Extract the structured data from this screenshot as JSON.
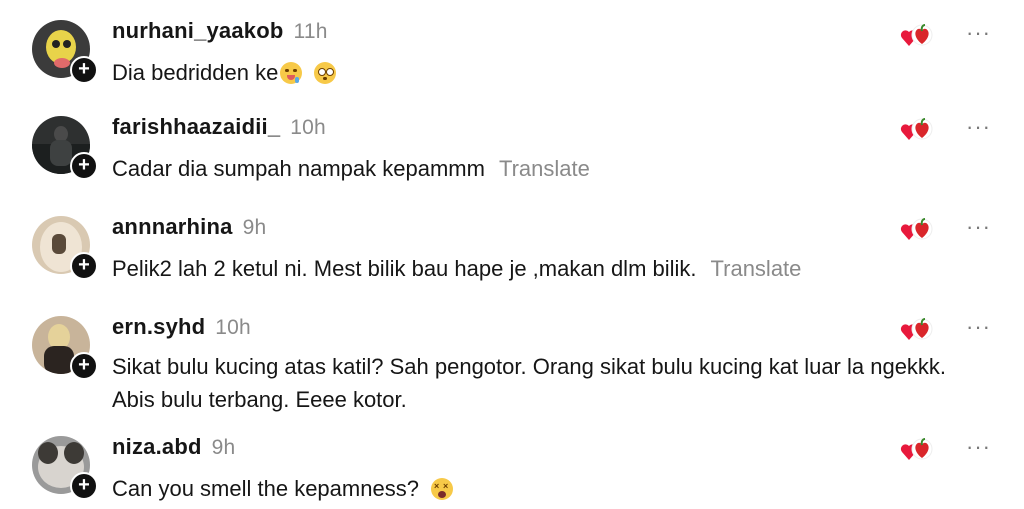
{
  "comments": [
    {
      "username": "nurhani_yaakob",
      "time": "11h",
      "text": "Dia bedridden ke",
      "translate": "",
      "avatar_color": "#3b3b3b",
      "emojis": [
        "drooling-face",
        "flushed-face"
      ]
    },
    {
      "username": "farishhaazaidii_",
      "time": "10h",
      "text": "Cadar dia sumpah nampak kepammm",
      "translate": "Translate",
      "avatar_color": "#2e3030",
      "emojis": []
    },
    {
      "username": "annnarhina",
      "time": "9h",
      "text": "Pelik2 lah 2 ketul ni. Mest bilik bau hape je ,makan dlm bilik.",
      "translate": "Translate",
      "avatar_color": "#d9c9b2",
      "emojis": []
    },
    {
      "username": "ern.syhd",
      "time": "10h",
      "text": "Sikat bulu kucing atas katil? Sah pengotor. Orang sikat bulu kucing kat luar la ngekkk. Abis bulu terbang. Eeee kotor.",
      "translate": "",
      "avatar_color": "#c8b49a",
      "emojis": []
    },
    {
      "username": "niza.abd",
      "time": "9h",
      "text": "Can you smell the kepamness?",
      "translate": "",
      "avatar_color": "#9a9a9a",
      "emojis": [
        "dizzy-face"
      ]
    }
  ],
  "more_label": "···",
  "follow_label": "+"
}
